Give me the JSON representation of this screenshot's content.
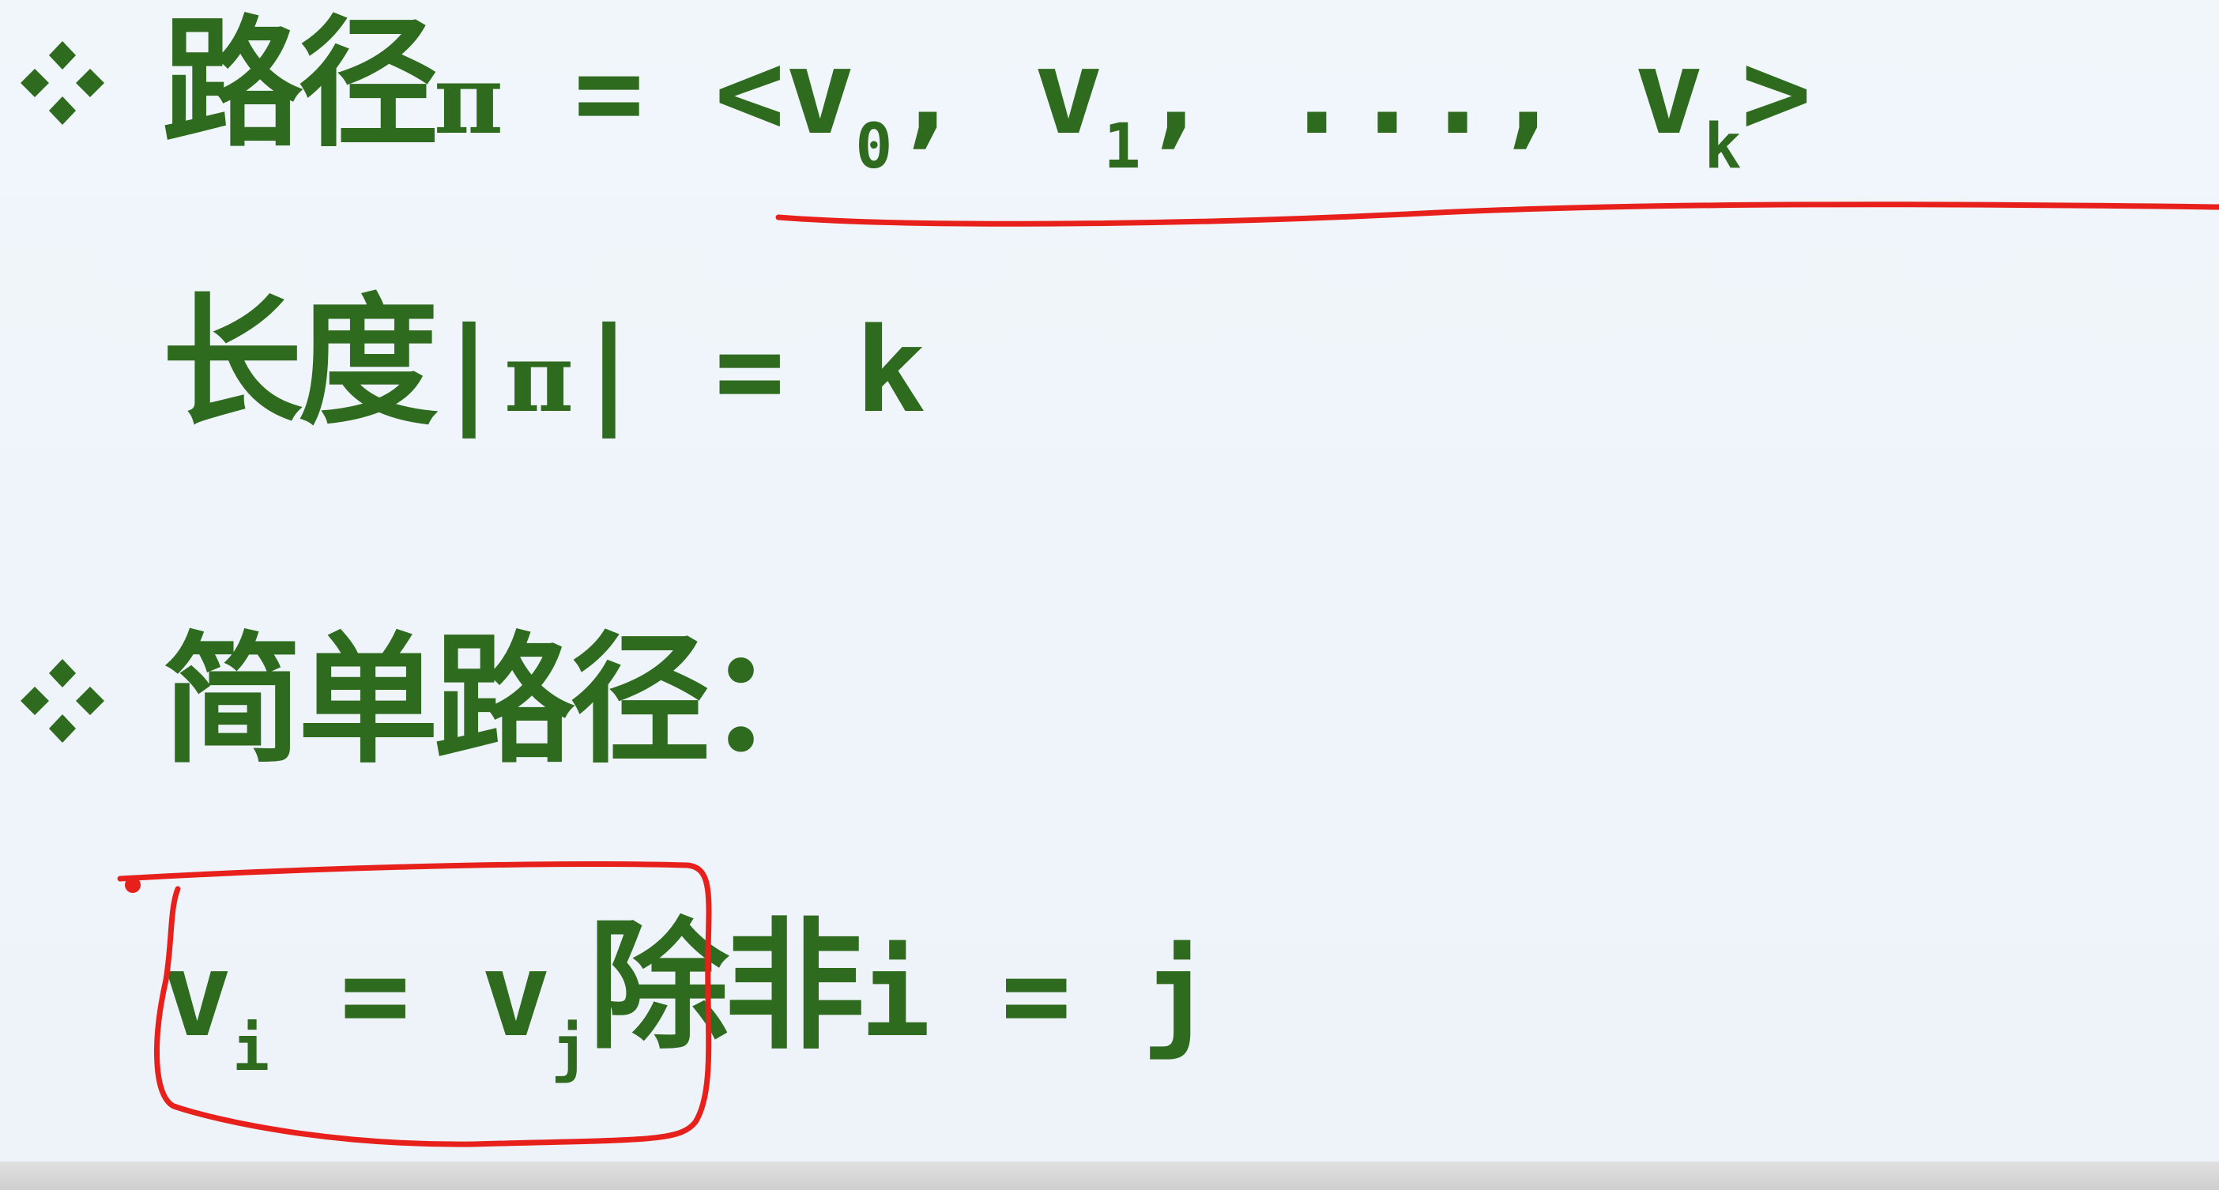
{
  "slide": {
    "bullet_icon": "four-diamond-bullet-icon",
    "text_color": "#2f6b1f",
    "annotation_color": "#e8201c",
    "path_def": {
      "term": "路径",
      "symbol": "π",
      "equals": " = ",
      "open": "<v",
      "sub0": "0",
      "sep1": ", v",
      "sub1": "1",
      "ellipsis": ", ..., v",
      "subk": "k",
      "close": ">"
    },
    "length_def": {
      "term": "长度",
      "bar_left": "|",
      "symbol": "π",
      "bar_right": "|",
      "rest": " = k"
    },
    "simple_path": {
      "term": "简单路径",
      "colon": "："
    },
    "condition": {
      "v_left": "v",
      "sub_i": "i",
      "equals": " = v",
      "sub_j": "j",
      "unless": "除非",
      "rest": "i = j"
    }
  }
}
